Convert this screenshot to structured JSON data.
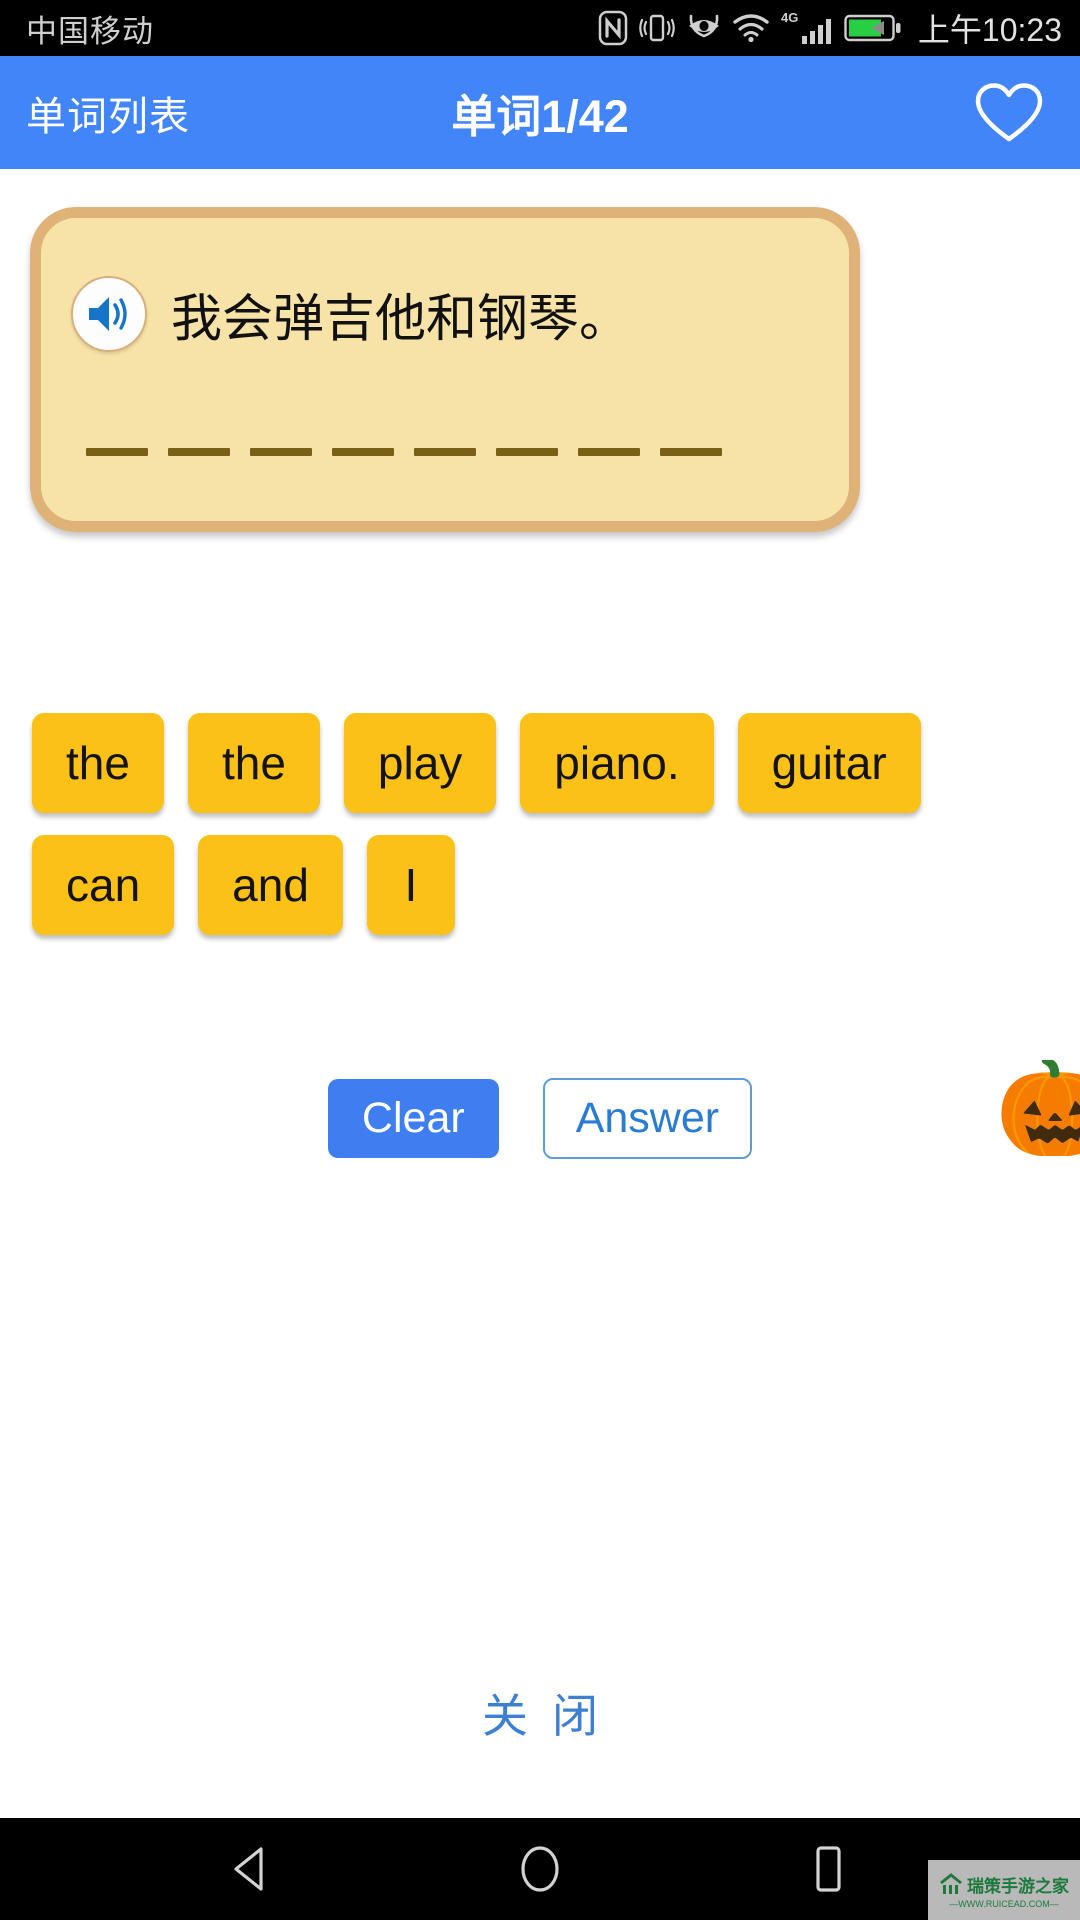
{
  "status_bar": {
    "carrier": "中国移动",
    "clock": "上午10:23",
    "icons": [
      "nfc-icon",
      "vibrate-icon",
      "eye-comfort-icon",
      "wifi-icon",
      "signal-4g-icon",
      "battery-charging-icon"
    ],
    "network": "4G",
    "battery_color": "#27d043"
  },
  "app_bar": {
    "back_label": "单词列表",
    "title": "单词1/42",
    "favorite_icon": "heart-outline-icon",
    "background": "#4285f8"
  },
  "card": {
    "sentence": "我会弹吉他和钢琴。",
    "speaker_icon": "speaker-volume-icon",
    "blank_count": 8,
    "background": "#f7e3a8",
    "border_color": "#dfb277",
    "blank_color": "#7a6014"
  },
  "word_tiles": {
    "color": "#fbc117",
    "items": [
      {
        "label": "the"
      },
      {
        "label": "the"
      },
      {
        "label": "play"
      },
      {
        "label": "piano."
      },
      {
        "label": "guitar"
      },
      {
        "label": "can"
      },
      {
        "label": "and"
      },
      {
        "label": "I"
      }
    ]
  },
  "actions": {
    "clear_label": "Clear",
    "answer_label": "Answer",
    "clear_color": "#3f7ef0",
    "answer_text_color": "#2a7bd4",
    "decoration_icon": "jack-o-lantern-witch-hat",
    "decoration_glyph": "🎃"
  },
  "footer": {
    "close_label": "关闭",
    "close_color": "#3d7fd0"
  },
  "nav_bar": {
    "back_icon": "back-triangle-icon",
    "home_icon": "home-circle-icon",
    "recents_icon": "recents-square-icon"
  },
  "watermark": {
    "name": "瑞策手游之家",
    "url": "—WWW.RUICEAD.COM—",
    "logo_icon": "house-logo-icon"
  }
}
